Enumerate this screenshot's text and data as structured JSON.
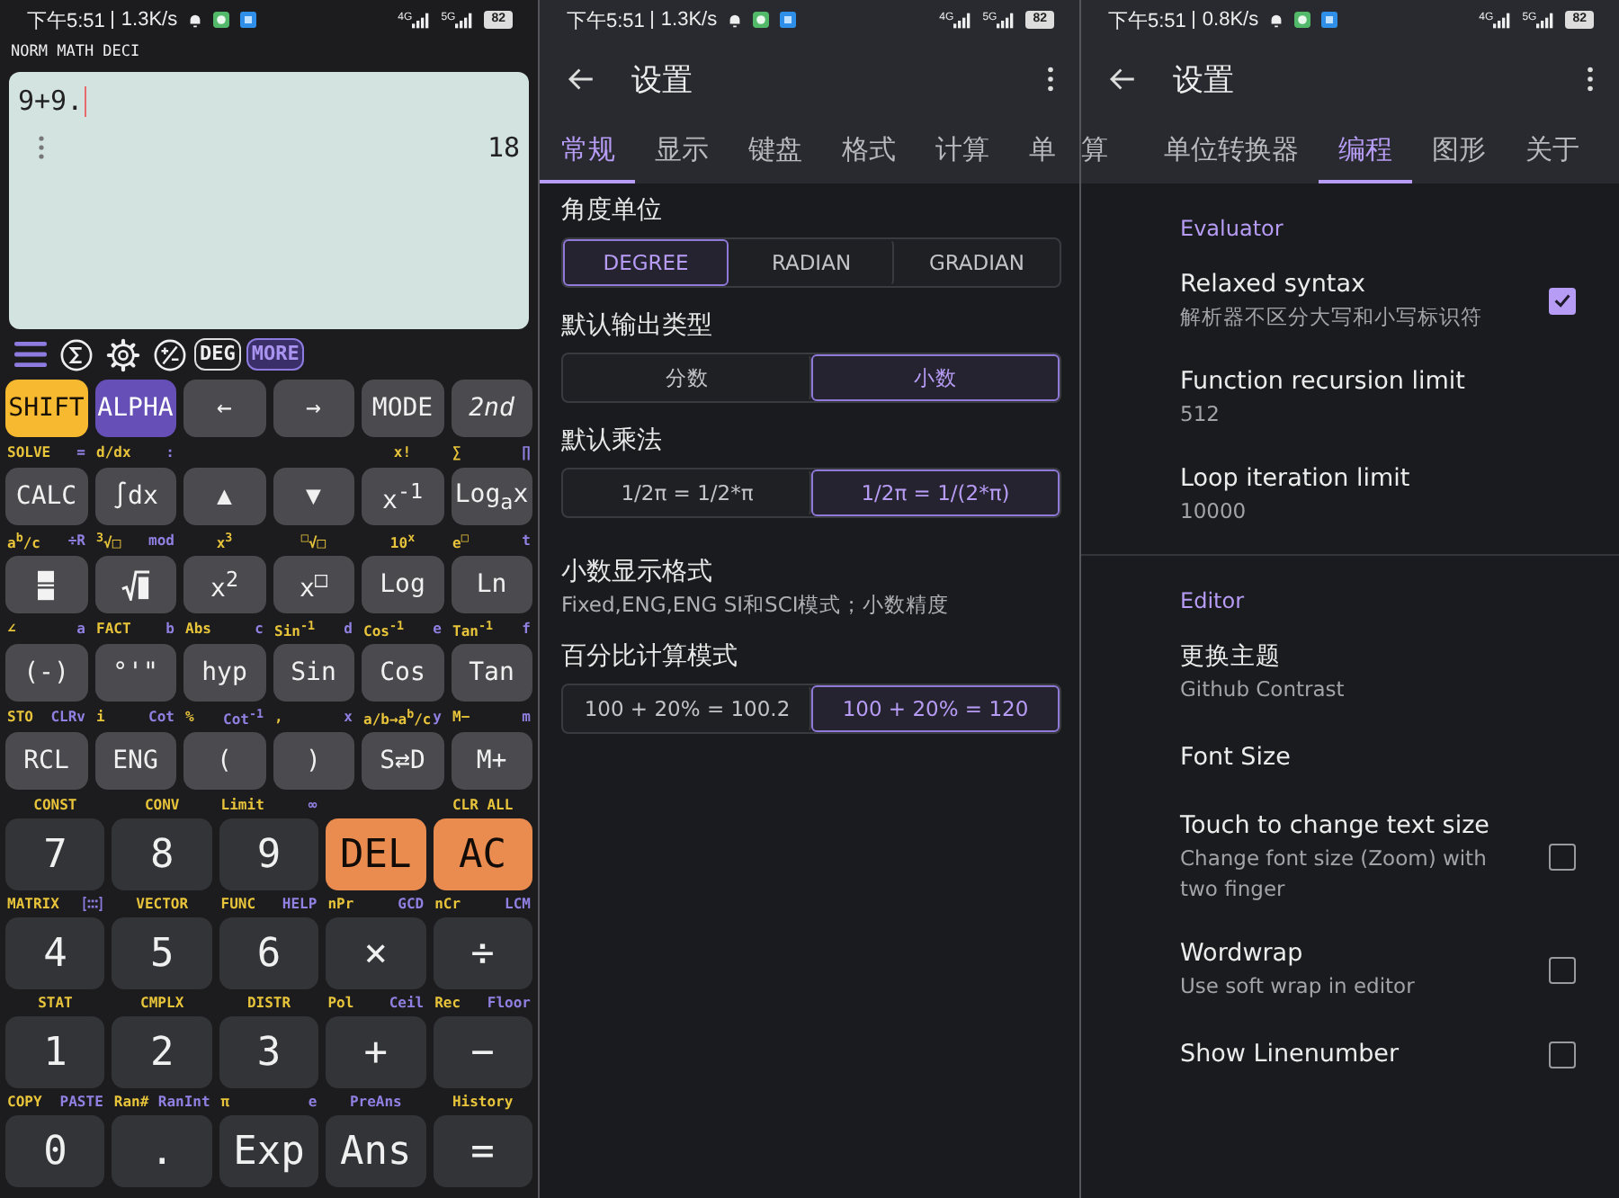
{
  "calculator": {
    "status": {
      "time": "下午5:51",
      "speed": "1.3K/s",
      "networks": [
        "4G",
        "5G"
      ],
      "battery": "82"
    },
    "mode_line": "NORM MATH DECI",
    "display": {
      "expression": "9+9.",
      "result": "18"
    },
    "toolbar": [
      {
        "kind": "menu"
      },
      {
        "kind": "sigma"
      },
      {
        "kind": "gear"
      },
      {
        "kind": "plusminus"
      },
      {
        "kind": "outlined",
        "label": "DEG"
      },
      {
        "kind": "accent",
        "label": "MORE"
      }
    ],
    "keypad": [
      [
        {
          "label": "SHIFT",
          "kind": "shift"
        },
        {
          "label": "ALPHA",
          "kind": "alpha"
        },
        {
          "label": "←",
          "kind": "gray"
        },
        {
          "label": "→",
          "kind": "gray"
        },
        {
          "label": "MODE",
          "kind": "gray"
        },
        {
          "label": "2nd",
          "kind": "italic"
        }
      ],
      [
        {
          "label": "CALC",
          "kind": "gray",
          "shift": "SOLVE",
          "alpha": "="
        },
        {
          "label": "∫dx",
          "kind": "gray",
          "shift": "d/dx",
          "alpha": ":"
        },
        {
          "label": "▲",
          "kind": "gray"
        },
        {
          "label": "▼",
          "kind": "gray"
        },
        {
          "label": "x$^{-1}$",
          "kind": "gray",
          "shift": "x!"
        },
        {
          "label": "Log$_{a}$x",
          "kind": "gray",
          "shift": "∑",
          "alpha": "∏"
        }
      ],
      [
        {
          "kind": "frac",
          "shift": "a$^{b}$/c",
          "alpha": "÷R"
        },
        {
          "kind": "sqrt",
          "shift": "$^{3}$√□",
          "alpha": "mod"
        },
        {
          "label": "x$^{2}$",
          "kind": "gray",
          "shift": "x$^{3}$"
        },
        {
          "label": "x$^{□}$",
          "kind": "gray",
          "shift": "$^{□}$√□"
        },
        {
          "label": "Log",
          "kind": "gray",
          "shift": "10$^{x}$"
        },
        {
          "label": "Ln",
          "kind": "gray",
          "shift": "e$^{□}$",
          "alpha": "t"
        }
      ],
      [
        {
          "label": "(-)",
          "kind": "gray",
          "shift": "∠",
          "alpha": "a"
        },
        {
          "label": "°'\"",
          "kind": "gray",
          "shift": "FACT",
          "alpha": "b"
        },
        {
          "label": "hyp",
          "kind": "gray",
          "shift": "Abs",
          "alpha": "c"
        },
        {
          "label": "Sin",
          "kind": "gray",
          "shift": "Sin$^{-1}$",
          "alpha": "d"
        },
        {
          "label": "Cos",
          "kind": "gray",
          "shift": "Cos$^{-1}$",
          "alpha": "e"
        },
        {
          "label": "Tan",
          "kind": "gray",
          "shift": "Tan$^{-1}$",
          "alpha": "f"
        }
      ],
      [
        {
          "label": "RCL",
          "kind": "gray",
          "shift": "STO",
          "alpha": "CLRv"
        },
        {
          "label": "ENG",
          "kind": "gray",
          "shift": "i",
          "alpha": "Cot"
        },
        {
          "label": "(",
          "kind": "gray",
          "shift": "%",
          "alpha": "Cot$^{-1}$"
        },
        {
          "label": ")",
          "kind": "gray",
          "shift": ",",
          "alpha": "x"
        },
        {
          "label": "S⇄D",
          "kind": "gray",
          "shift": "a/b→a$^{b}$/c",
          "alpha": "y"
        },
        {
          "label": "M+",
          "kind": "gray",
          "shift": "M−",
          "alpha": "m"
        }
      ],
      [
        {
          "label": "7",
          "kind": "gray",
          "shift": "CONST"
        },
        {
          "label": "8",
          "kind": "gray",
          "shift": "CONV"
        },
        {
          "label": "9",
          "kind": "gray",
          "shift": "Limit",
          "alpha": "∞"
        },
        {
          "label": "DEL",
          "kind": "orange"
        },
        {
          "label": "AC",
          "kind": "orange",
          "shift": "CLR ALL"
        }
      ],
      [
        {
          "label": "4",
          "kind": "gray",
          "shift": "MATRIX",
          "alpha_icon": true
        },
        {
          "label": "5",
          "kind": "gray",
          "shift": "VECTOR"
        },
        {
          "label": "6",
          "kind": "gray",
          "shift": "FUNC",
          "alpha": "HELP"
        },
        {
          "label": "×",
          "kind": "gray",
          "shift": "nPr",
          "alpha": "GCD"
        },
        {
          "label": "÷",
          "kind": "gray",
          "shift": "nCr",
          "alpha": "LCM"
        }
      ],
      [
        {
          "label": "1",
          "kind": "gray",
          "shift": "STAT"
        },
        {
          "label": "2",
          "kind": "gray",
          "shift": "CMPLX"
        },
        {
          "label": "3",
          "kind": "gray",
          "shift": "DISTR"
        },
        {
          "label": "+",
          "kind": "gray",
          "shift": "Pol",
          "alpha": "Ceil"
        },
        {
          "label": "−",
          "kind": "gray",
          "shift": "Rec",
          "alpha": "Floor"
        }
      ],
      [
        {
          "label": "0",
          "kind": "gray",
          "shift": "COPY",
          "alpha": "PASTE"
        },
        {
          "label": ".",
          "kind": "gray",
          "shift": "Ran#",
          "alpha": "RanInt"
        },
        {
          "label": "Exp",
          "kind": "gray",
          "shift": "π",
          "alpha": "e"
        },
        {
          "label": "Ans",
          "kind": "gray",
          "alpha": "PreAns"
        },
        {
          "label": "=",
          "kind": "gray",
          "shift": "History"
        }
      ]
    ]
  },
  "general": {
    "status": {
      "time": "下午5:51",
      "speed": "1.3K/s",
      "networks": [
        "4G",
        "5G"
      ],
      "battery": "82"
    },
    "title": "设置",
    "tabs": [
      {
        "label": "常规",
        "selected": true
      },
      {
        "label": "显示",
        "selected": false
      },
      {
        "label": "键盘",
        "selected": false
      },
      {
        "label": "格式",
        "selected": false
      },
      {
        "label": "计算",
        "selected": false
      },
      {
        "label": "单",
        "selected": false
      }
    ],
    "settings": [
      {
        "kind": "segmented",
        "title": "角度单位",
        "options": [
          {
            "label": "DEGREE",
            "selected": true
          },
          {
            "label": "RADIAN",
            "selected": false
          },
          {
            "label": "GRADIAN",
            "selected": false
          }
        ]
      },
      {
        "kind": "segmented",
        "title": "默认输出类型",
        "options": [
          {
            "label": "分数",
            "selected": false
          },
          {
            "label": "小数",
            "selected": true
          }
        ]
      },
      {
        "kind": "segmented",
        "title": "默认乘法",
        "options": [
          {
            "label": "1/2π = 1/2*π",
            "selected": false
          },
          {
            "label": "1/2π = 1/(2*π)",
            "selected": true
          }
        ]
      },
      {
        "kind": "info",
        "title": "小数显示格式",
        "subtitle": "Fixed,ENG,ENG SI和SCI模式；小数精度"
      },
      {
        "kind": "segmented",
        "title": "百分比计算模式",
        "options": [
          {
            "label": "100 + 20% = 100.2",
            "selected": false
          },
          {
            "label": "100 + 20% = 120",
            "selected": true
          }
        ]
      }
    ]
  },
  "programming": {
    "status": {
      "time": "下午5:51",
      "speed": "0.8K/s",
      "networks": [
        "4G",
        "5G"
      ],
      "battery": "82"
    },
    "title": "设置",
    "tabs": [
      {
        "label": "算",
        "selected": false
      },
      {
        "label": "单位转换器",
        "selected": false
      },
      {
        "label": "编程",
        "selected": true
      },
      {
        "label": "图形",
        "selected": false
      },
      {
        "label": "关于",
        "selected": false
      }
    ],
    "groups": [
      {
        "title": "Evaluator",
        "items": [
          {
            "title": "Relaxed syntax",
            "subtitle": "解析器不区分大写和小写标识符",
            "checked": true
          },
          {
            "title": "Function recursion limit",
            "subtitle": "512"
          },
          {
            "title": "Loop iteration limit",
            "subtitle": "10000"
          }
        ]
      },
      {
        "title": "Editor",
        "items": [
          {
            "title": "更换主题",
            "subtitle": "Github Contrast"
          },
          {
            "title": "Font Size"
          },
          {
            "title": "Touch to change text size",
            "subtitle": "Change font size (Zoom) with two finger",
            "checked": false
          },
          {
            "title": "Wordwrap",
            "subtitle": "Use soft wrap in editor",
            "checked": false
          },
          {
            "title": "Show Linenumber",
            "checked": false
          }
        ]
      }
    ]
  }
}
